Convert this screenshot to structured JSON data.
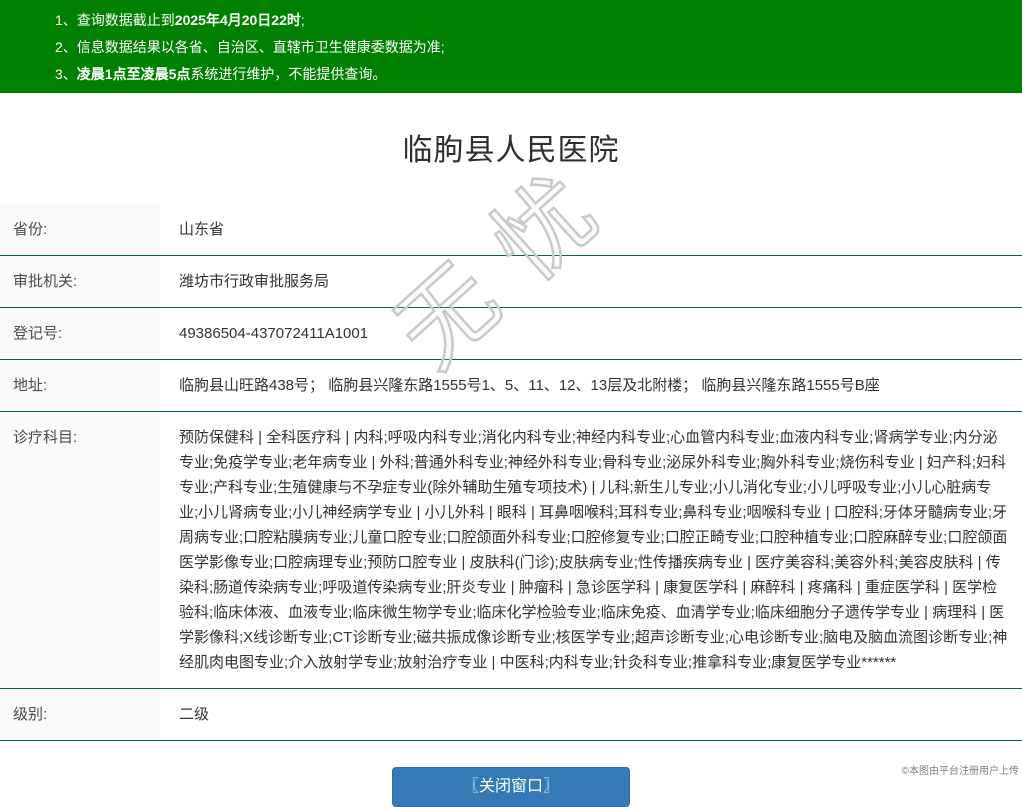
{
  "banner": {
    "notices": [
      {
        "prefix": "1、查询数据截止到",
        "bold": "2025年4月20日22时",
        "suffix": ";"
      },
      {
        "prefix": "2、信息数据结果以各省、自治区、直辖市卫生健康委数据为准;",
        "bold": "",
        "suffix": ""
      },
      {
        "prefix": "3、",
        "bold": "凌晨1点至凌晨5点",
        "suffix": "系统进行维护，不能提供查询。"
      }
    ]
  },
  "page_title": "临朐县人民医院",
  "info_table": {
    "rows": [
      {
        "label": "省份:",
        "value": "山东省"
      },
      {
        "label": "审批机关:",
        "value": "潍坊市行政审批服务局"
      },
      {
        "label": "登记号:",
        "value": "49386504-437072411A1001"
      },
      {
        "label": "地址:",
        "value": "临朐县山旺路438号；  临朐县兴隆东路1555号1、5、11、12、13层及北附楼；  临朐县兴隆东路1555号B座"
      },
      {
        "label": "诊疗科目:",
        "value": "预防保健科 | 全科医疗科 | 内科;呼吸内科专业;消化内科专业;神经内科专业;心血管内科专业;血液内科专业;肾病学专业;内分泌专业;免疫学专业;老年病专业 | 外科;普通外科专业;神经外科专业;骨科专业;泌尿外科专业;胸外科专业;烧伤科专业 | 妇产科;妇科专业;产科专业;生殖健康与不孕症专业(除外辅助生殖专项技术) | 儿科;新生儿专业;小儿消化专业;小儿呼吸专业;小儿心脏病专业;小儿肾病专业;小儿神经病学专业 | 小儿外科 | 眼科 | 耳鼻咽喉科;耳科专业;鼻科专业;咽喉科专业 | 口腔科;牙体牙髓病专业;牙周病专业;口腔粘膜病专业;儿童口腔专业;口腔颌面外科专业;口腔修复专业;口腔正畸专业;口腔种植专业;口腔麻醉专业;口腔颌面医学影像专业;口腔病理专业;预防口腔专业 | 皮肤科(门诊);皮肤病专业;性传播疾病专业 | 医疗美容科;美容外科;美容皮肤科 | 传染科;肠道传染病专业;呼吸道传染病专业;肝炎专业 | 肿瘤科 | 急诊医学科 | 康复医学科 | 麻醉科 | 疼痛科 | 重症医学科 | 医学检验科;临床体液、血液专业;临床微生物学专业;临床化学检验专业;临床免疫、血清学专业;临床细胞分子遗传学专业 | 病理科 | 医学影像科;X线诊断专业;CT诊断专业;磁共振成像诊断专业;核医学专业;超声诊断专业;心电诊断专业;脑电及脑血流图诊断专业;神经肌肉电图专业;介入放射学专业;放射治疗专业 | 中医科;内科专业;针灸科专业;推拿科专业;康复医学专业******"
      },
      {
        "label": "级别:",
        "value": "二级"
      }
    ]
  },
  "footer": {
    "close_button": "〖关闭窗口〗",
    "upload_note": "©本图由平台注册用户上传"
  },
  "watermark": {
    "text": "无忧"
  },
  "colors": {
    "banner_green": "#008000",
    "divider_green": "#006e2e",
    "button_blue": "#337ab7"
  }
}
